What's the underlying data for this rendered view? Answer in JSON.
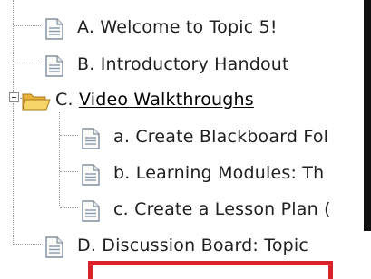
{
  "tree": {
    "items": [
      {
        "label": "A. Welcome to Topic 5!",
        "type": "document"
      },
      {
        "label": "B. Introductory Handout",
        "type": "document"
      },
      {
        "label": "C. ",
        "link": "Video Walkthroughs",
        "type": "folder",
        "expanded": true,
        "children": [
          {
            "label": "a. Create Blackboard Fol",
            "type": "document"
          },
          {
            "label": "b. Learning Modules: Th",
            "type": "document"
          },
          {
            "label": "c. Create a Lesson Plan (",
            "type": "document"
          }
        ]
      },
      {
        "label": "D. Discussion Board: Topic",
        "type": "document"
      }
    ]
  },
  "colors": {
    "text": "#1f1f1f",
    "connector": "#9a9a9a",
    "highlight": "#d8232a",
    "folder": "#f2c64a"
  },
  "icons": {
    "document": "document-icon",
    "folder": "folder-open-icon",
    "toggle": "collapse-minus-icon"
  }
}
